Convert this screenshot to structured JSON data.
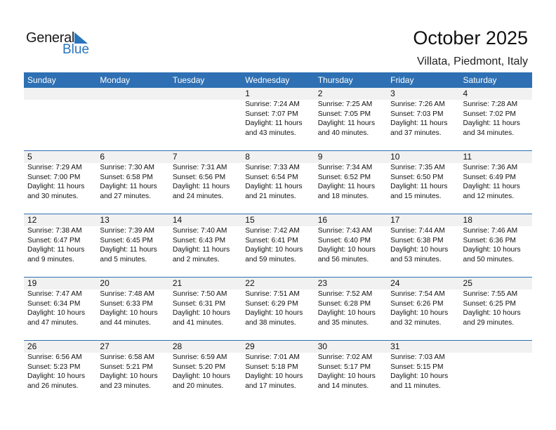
{
  "logo": {
    "word1": "General",
    "word2": "Blue",
    "accent_color": "#2a76bd"
  },
  "header": {
    "title": "October 2025",
    "location": "Villata, Piedmont, Italy"
  },
  "theme": {
    "header_bg": "#2e70b3",
    "day_row_bg": "#f1f1f1"
  },
  "weekdays": [
    "Sunday",
    "Monday",
    "Tuesday",
    "Wednesday",
    "Thursday",
    "Friday",
    "Saturday"
  ],
  "weeks": [
    [
      null,
      null,
      null,
      {
        "day": "1",
        "sunrise": "Sunrise: 7:24 AM",
        "sunset": "Sunset: 7:07 PM",
        "daylight1": "Daylight: 11 hours",
        "daylight2": "and 43 minutes."
      },
      {
        "day": "2",
        "sunrise": "Sunrise: 7:25 AM",
        "sunset": "Sunset: 7:05 PM",
        "daylight1": "Daylight: 11 hours",
        "daylight2": "and 40 minutes."
      },
      {
        "day": "3",
        "sunrise": "Sunrise: 7:26 AM",
        "sunset": "Sunset: 7:03 PM",
        "daylight1": "Daylight: 11 hours",
        "daylight2": "and 37 minutes."
      },
      {
        "day": "4",
        "sunrise": "Sunrise: 7:28 AM",
        "sunset": "Sunset: 7:02 PM",
        "daylight1": "Daylight: 11 hours",
        "daylight2": "and 34 minutes."
      }
    ],
    [
      {
        "day": "5",
        "sunrise": "Sunrise: 7:29 AM",
        "sunset": "Sunset: 7:00 PM",
        "daylight1": "Daylight: 11 hours",
        "daylight2": "and 30 minutes."
      },
      {
        "day": "6",
        "sunrise": "Sunrise: 7:30 AM",
        "sunset": "Sunset: 6:58 PM",
        "daylight1": "Daylight: 11 hours",
        "daylight2": "and 27 minutes."
      },
      {
        "day": "7",
        "sunrise": "Sunrise: 7:31 AM",
        "sunset": "Sunset: 6:56 PM",
        "daylight1": "Daylight: 11 hours",
        "daylight2": "and 24 minutes."
      },
      {
        "day": "8",
        "sunrise": "Sunrise: 7:33 AM",
        "sunset": "Sunset: 6:54 PM",
        "daylight1": "Daylight: 11 hours",
        "daylight2": "and 21 minutes."
      },
      {
        "day": "9",
        "sunrise": "Sunrise: 7:34 AM",
        "sunset": "Sunset: 6:52 PM",
        "daylight1": "Daylight: 11 hours",
        "daylight2": "and 18 minutes."
      },
      {
        "day": "10",
        "sunrise": "Sunrise: 7:35 AM",
        "sunset": "Sunset: 6:50 PM",
        "daylight1": "Daylight: 11 hours",
        "daylight2": "and 15 minutes."
      },
      {
        "day": "11",
        "sunrise": "Sunrise: 7:36 AM",
        "sunset": "Sunset: 6:49 PM",
        "daylight1": "Daylight: 11 hours",
        "daylight2": "and 12 minutes."
      }
    ],
    [
      {
        "day": "12",
        "sunrise": "Sunrise: 7:38 AM",
        "sunset": "Sunset: 6:47 PM",
        "daylight1": "Daylight: 11 hours",
        "daylight2": "and 9 minutes."
      },
      {
        "day": "13",
        "sunrise": "Sunrise: 7:39 AM",
        "sunset": "Sunset: 6:45 PM",
        "daylight1": "Daylight: 11 hours",
        "daylight2": "and 5 minutes."
      },
      {
        "day": "14",
        "sunrise": "Sunrise: 7:40 AM",
        "sunset": "Sunset: 6:43 PM",
        "daylight1": "Daylight: 11 hours",
        "daylight2": "and 2 minutes."
      },
      {
        "day": "15",
        "sunrise": "Sunrise: 7:42 AM",
        "sunset": "Sunset: 6:41 PM",
        "daylight1": "Daylight: 10 hours",
        "daylight2": "and 59 minutes."
      },
      {
        "day": "16",
        "sunrise": "Sunrise: 7:43 AM",
        "sunset": "Sunset: 6:40 PM",
        "daylight1": "Daylight: 10 hours",
        "daylight2": "and 56 minutes."
      },
      {
        "day": "17",
        "sunrise": "Sunrise: 7:44 AM",
        "sunset": "Sunset: 6:38 PM",
        "daylight1": "Daylight: 10 hours",
        "daylight2": "and 53 minutes."
      },
      {
        "day": "18",
        "sunrise": "Sunrise: 7:46 AM",
        "sunset": "Sunset: 6:36 PM",
        "daylight1": "Daylight: 10 hours",
        "daylight2": "and 50 minutes."
      }
    ],
    [
      {
        "day": "19",
        "sunrise": "Sunrise: 7:47 AM",
        "sunset": "Sunset: 6:34 PM",
        "daylight1": "Daylight: 10 hours",
        "daylight2": "and 47 minutes."
      },
      {
        "day": "20",
        "sunrise": "Sunrise: 7:48 AM",
        "sunset": "Sunset: 6:33 PM",
        "daylight1": "Daylight: 10 hours",
        "daylight2": "and 44 minutes."
      },
      {
        "day": "21",
        "sunrise": "Sunrise: 7:50 AM",
        "sunset": "Sunset: 6:31 PM",
        "daylight1": "Daylight: 10 hours",
        "daylight2": "and 41 minutes."
      },
      {
        "day": "22",
        "sunrise": "Sunrise: 7:51 AM",
        "sunset": "Sunset: 6:29 PM",
        "daylight1": "Daylight: 10 hours",
        "daylight2": "and 38 minutes."
      },
      {
        "day": "23",
        "sunrise": "Sunrise: 7:52 AM",
        "sunset": "Sunset: 6:28 PM",
        "daylight1": "Daylight: 10 hours",
        "daylight2": "and 35 minutes."
      },
      {
        "day": "24",
        "sunrise": "Sunrise: 7:54 AM",
        "sunset": "Sunset: 6:26 PM",
        "daylight1": "Daylight: 10 hours",
        "daylight2": "and 32 minutes."
      },
      {
        "day": "25",
        "sunrise": "Sunrise: 7:55 AM",
        "sunset": "Sunset: 6:25 PM",
        "daylight1": "Daylight: 10 hours",
        "daylight2": "and 29 minutes."
      }
    ],
    [
      {
        "day": "26",
        "sunrise": "Sunrise: 6:56 AM",
        "sunset": "Sunset: 5:23 PM",
        "daylight1": "Daylight: 10 hours",
        "daylight2": "and 26 minutes."
      },
      {
        "day": "27",
        "sunrise": "Sunrise: 6:58 AM",
        "sunset": "Sunset: 5:21 PM",
        "daylight1": "Daylight: 10 hours",
        "daylight2": "and 23 minutes."
      },
      {
        "day": "28",
        "sunrise": "Sunrise: 6:59 AM",
        "sunset": "Sunset: 5:20 PM",
        "daylight1": "Daylight: 10 hours",
        "daylight2": "and 20 minutes."
      },
      {
        "day": "29",
        "sunrise": "Sunrise: 7:01 AM",
        "sunset": "Sunset: 5:18 PM",
        "daylight1": "Daylight: 10 hours",
        "daylight2": "and 17 minutes."
      },
      {
        "day": "30",
        "sunrise": "Sunrise: 7:02 AM",
        "sunset": "Sunset: 5:17 PM",
        "daylight1": "Daylight: 10 hours",
        "daylight2": "and 14 minutes."
      },
      {
        "day": "31",
        "sunrise": "Sunrise: 7:03 AM",
        "sunset": "Sunset: 5:15 PM",
        "daylight1": "Daylight: 10 hours",
        "daylight2": "and 11 minutes."
      },
      null
    ]
  ]
}
